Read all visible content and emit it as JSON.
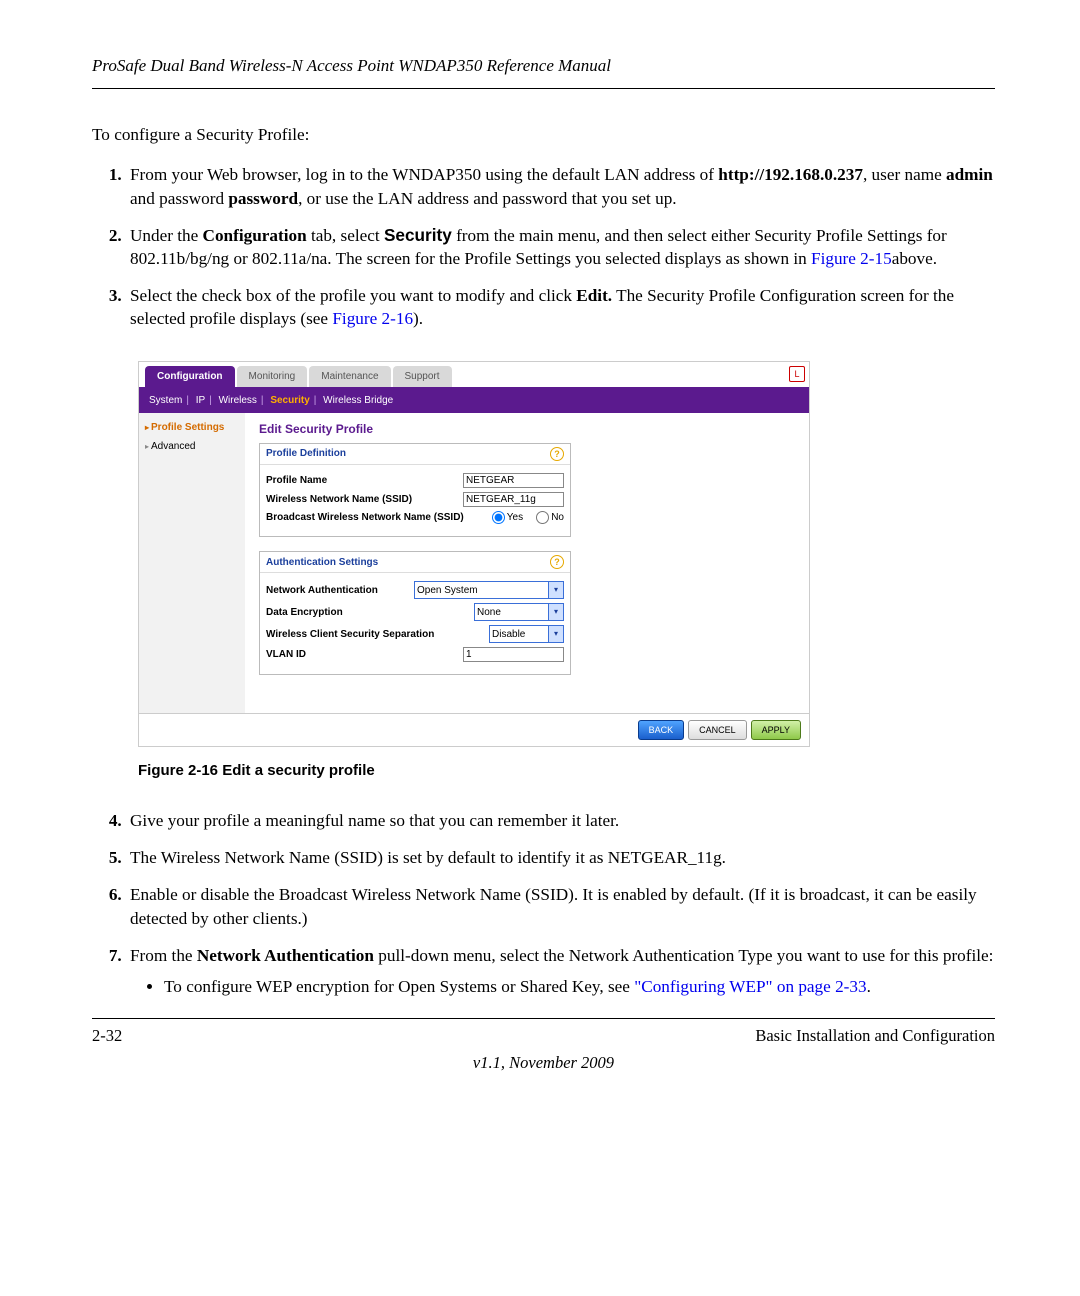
{
  "doc": {
    "header_title": "ProSafe Dual Band Wireless-N Access Point WNDAP350 Reference Manual",
    "intro": "To configure a Security Profile:",
    "step1_a": "From your Web browser, log in to the WNDAP350 using the default LAN address of ",
    "step1_url": "http://192.168.0.237",
    "step1_b": ", user name ",
    "step1_user": "admin",
    "step1_c": " and password ",
    "step1_pass": "password",
    "step1_d": ", or use the LAN address and password that you set up.",
    "step2_a": "Under the ",
    "step2_conf": "Configuration",
    "step2_b": " tab, select ",
    "step2_sec": "Security",
    "step2_c": " from the main menu, and then select either Security Profile Settings for 802.11b/bg/ng or 802.11a/na. The screen for the Profile Settings you selected displays as shown in ",
    "step2_link": "Figure 2-15",
    "step2_d": "above.",
    "step3_a": "Select the check box of the profile you want to modify and click ",
    "step3_edit": "Edit.",
    "step3_b": " The Security Profile Configuration screen for the selected profile displays (see ",
    "step3_link": "Figure 2-16",
    "step3_c": ").",
    "fig_caption": "Figure 2-16  Edit a security profile",
    "step4": "Give your profile a meaningful name so that you can remember it later.",
    "step5": "The Wireless Network Name (SSID) is set by default to identify it as NETGEAR_11g.",
    "step6": "Enable or disable the Broadcast Wireless Network Name (SSID). It is enabled by default. (If it is broadcast, it can be easily detected by other clients.)",
    "step7_a": "From the ",
    "step7_na": "Network Authentication",
    "step7_b": " pull-down menu, select the Network Authentication Type you want to use for this profile:",
    "bullet1_a": "To configure WEP encryption for Open Systems or Shared Key, see ",
    "bullet1_link": "\"Configuring WEP\" on page 2-33",
    "bullet1_b": ".",
    "page_num": "2-32",
    "section": "Basic Installation and Configuration",
    "version": "v1.1, November 2009"
  },
  "ui": {
    "tabs": {
      "configuration": "Configuration",
      "monitoring": "Monitoring",
      "maintenance": "Maintenance",
      "support": "Support"
    },
    "submenu": {
      "system": "System",
      "ip": "IP",
      "wireless": "Wireless",
      "security": "Security",
      "bridge": "Wireless Bridge"
    },
    "sidebar": {
      "profile_settings": "Profile Settings",
      "advanced": "Advanced"
    },
    "main": {
      "title": "Edit Security Profile",
      "box1": {
        "header": "Profile Definition",
        "profile_name_label": "Profile Name",
        "profile_name_value": "NETGEAR",
        "ssid_label": "Wireless Network Name (SSID)",
        "ssid_value": "NETGEAR_11g",
        "broadcast_label": "Broadcast Wireless Network Name (SSID)",
        "yes": "Yes",
        "no": "No"
      },
      "box2": {
        "header": "Authentication Settings",
        "net_auth_label": "Network Authentication",
        "net_auth_value": "Open System",
        "data_enc_label": "Data Encryption",
        "data_enc_value": "None",
        "sep_label": "Wireless Client Security Separation",
        "sep_value": "Disable",
        "vlan_label": "VLAN ID",
        "vlan_value": "1"
      }
    },
    "footer": {
      "back": "BACK",
      "cancel": "CANCEL",
      "apply": "APPLY"
    }
  }
}
